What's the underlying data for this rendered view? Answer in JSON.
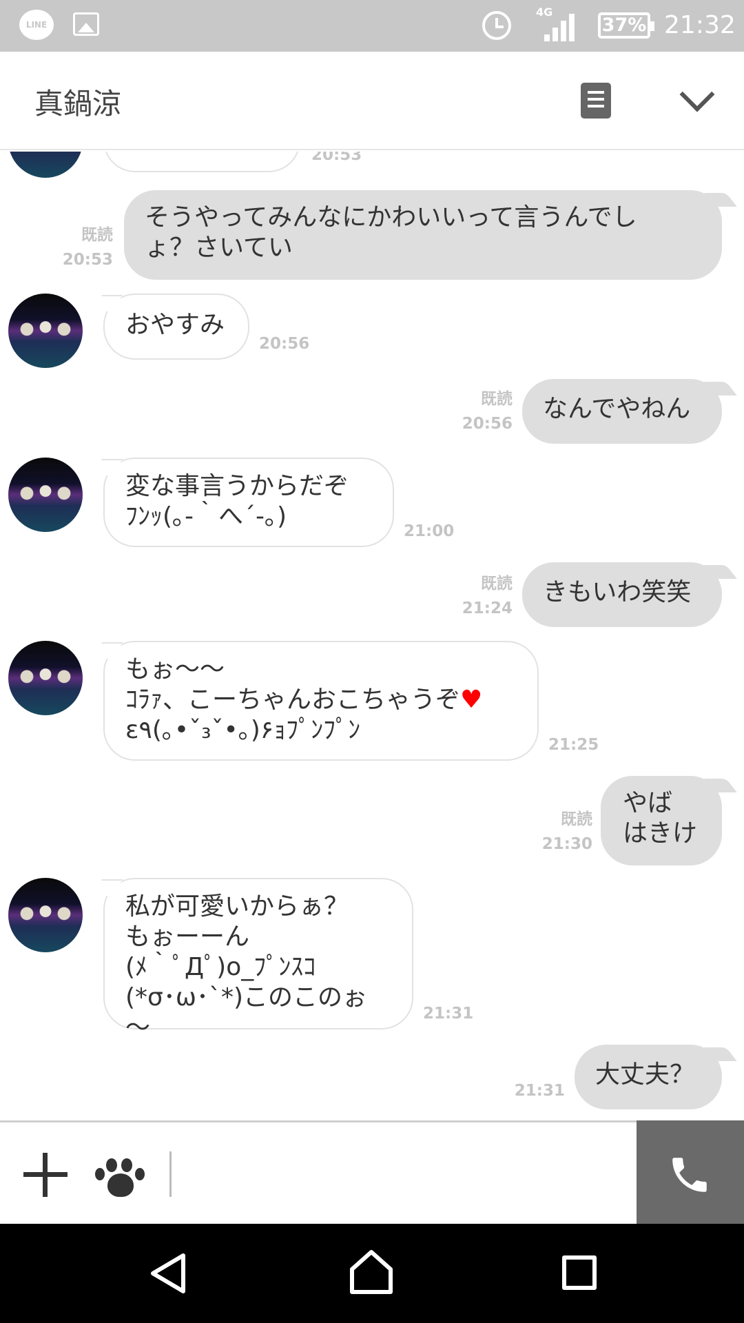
{
  "status_bar": {
    "line_label": "LINE",
    "network": "4G",
    "battery": "37%",
    "time": "21:32"
  },
  "header": {
    "title": "真鍋涼"
  },
  "messages": [
    {
      "id": "m0",
      "side": "in",
      "text": "",
      "time": "20:53"
    },
    {
      "id": "m1",
      "side": "out",
      "text": "そうやってみんなにかわいいって言うんでし\nょ？さいてい",
      "read": "既読",
      "time": "20:53"
    },
    {
      "id": "m2",
      "side": "in",
      "text": "おやすみ",
      "time": "20:56"
    },
    {
      "id": "m3",
      "side": "out",
      "text": "なんでやねん",
      "read": "既読",
      "time": "20:56"
    },
    {
      "id": "m4",
      "side": "in",
      "text": "変な事言うからだぞ\nﾌﾝｯ(｡-｀へ´-｡)",
      "time": "21:00"
    },
    {
      "id": "m5",
      "side": "out",
      "text": "きもいわ笑笑",
      "read": "既読",
      "time": "21:24"
    },
    {
      "id": "m6",
      "side": "in",
      "text": "もぉ～～\nｺﾗｧ、こーちゃんおこちゃうぞ",
      "text_line3": "ε٩(｡•ˇ₃ˇ•｡)۶ｮﾌﾟﾝﾌﾟﾝ",
      "emoji": "♥",
      "time": "21:25"
    },
    {
      "id": "m7",
      "side": "out",
      "text": "やば\nはきけ",
      "read": "既読",
      "time": "21:30"
    },
    {
      "id": "m8",
      "side": "in",
      "text": "私が可愛いからぁ？\nもぉーーん\n(ﾒ｀ﾟДﾟ)o_ﾌﾟﾝｽｺ\n(*σ･ω･`*)このこのぉ～",
      "time": "21:31"
    },
    {
      "id": "m9",
      "side": "out",
      "text": "大丈夫？",
      "time": "21:31"
    }
  ],
  "input_bar": {
    "placeholder": "",
    "icons": [
      "plus-icon",
      "paw-icon",
      "phone-icon"
    ]
  },
  "nav_bar": {
    "icons": [
      "back-icon",
      "home-icon",
      "recent-apps-icon"
    ]
  },
  "colors": {
    "status_bar": "#c8c8c8",
    "outgoing_bubble": "#dedede",
    "incoming_bubble": "#ffffff",
    "call_button": "#6a6a6a",
    "heart": "#ff0000"
  }
}
